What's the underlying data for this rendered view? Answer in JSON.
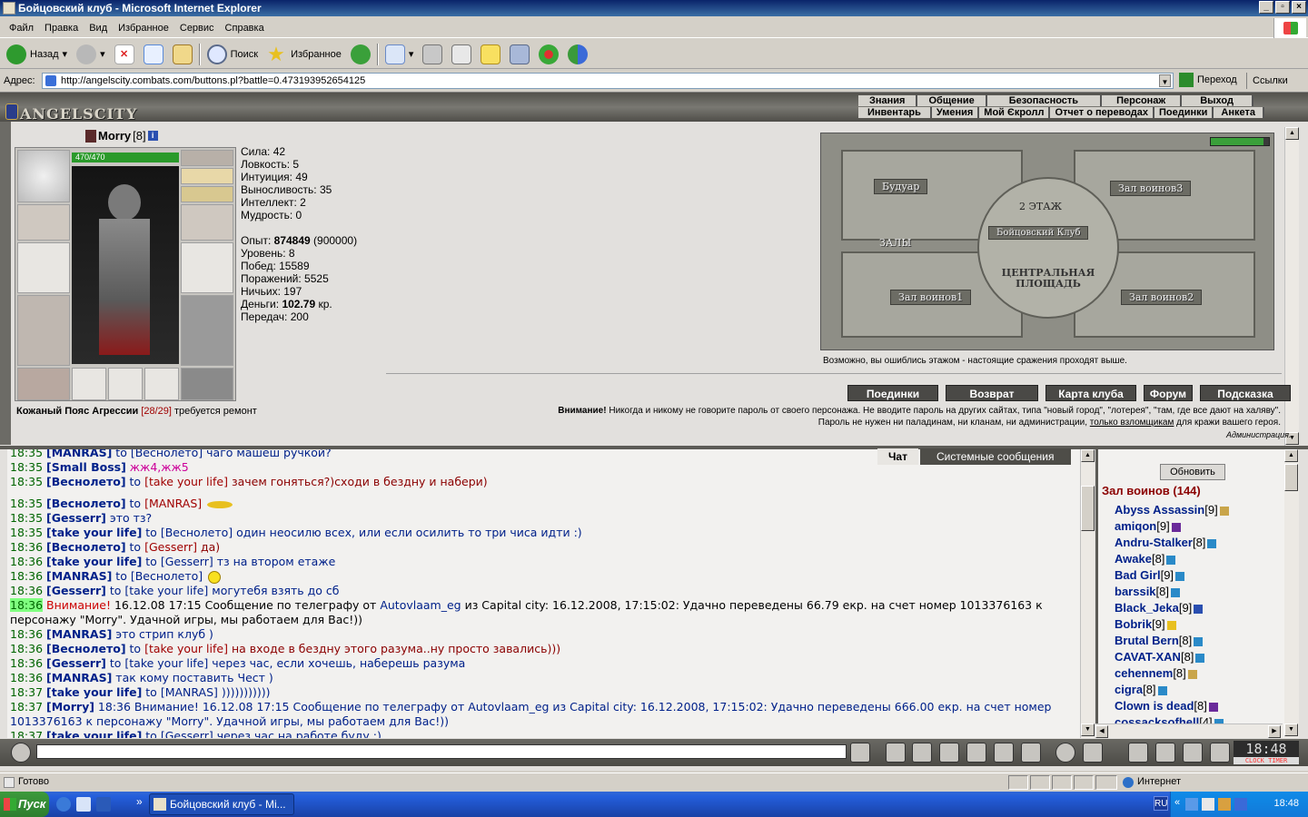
{
  "window": {
    "title": "Бойцовский клуб - Microsoft Internet Explorer"
  },
  "menu": [
    "Файл",
    "Правка",
    "Вид",
    "Избранное",
    "Сервис",
    "Справка"
  ],
  "toolbar": {
    "back": "Назад",
    "search": "Поиск",
    "favorites": "Избранное"
  },
  "address": {
    "label": "Адрес:",
    "url": "http://angelscity.combats.com/buttons.pl?battle=0.473193952654125",
    "go": "Переход",
    "links": "Ссылки"
  },
  "game": {
    "logo": "ANGELSCITY",
    "nav1": [
      "Знания",
      "Общение",
      "Безопасность",
      "Персонаж",
      "Выход"
    ],
    "nav2": [
      "Инвентарь",
      "Умения",
      "Мой Єкролл",
      "Отчет о переводах",
      "Поединки",
      "Анкета"
    ],
    "character": {
      "name": "Morry",
      "level": "[8]",
      "hp": "470/470",
      "hp_fraction": 1.0
    },
    "stats": {
      "strength": "Сила: 42",
      "agility": "Ловкость: 5",
      "intuition": "Интуиция: 49",
      "endurance": "Выносливость: 35",
      "intellect": "Интеллект: 2",
      "wisdom": "Мудрость: 0",
      "exp_label": "Опыт:",
      "exp_value": "874849",
      "exp_next": "(900000)",
      "level": "Уровень: 8",
      "wins": "Побед: 15589",
      "losses": "Поражений: 5525",
      "draws": "Ничьих: 197",
      "money_label": "Деньги:",
      "money_value": "102.79",
      "money_unit": "кр.",
      "transfers": "Передач: 200"
    },
    "belt": {
      "name": "Кожаный Пояс Агрессии",
      "durability": "[28/29]",
      "note": "требуется ремонт"
    },
    "map": {
      "boudoir": "Будуар",
      "floor2": "2 ЭТАЖ",
      "club": "Бойцовский Клуб",
      "halls": "ЗАЛЫ",
      "hall3": "Зал воинов3",
      "hall1": "Зал воинов1",
      "hall2": "Зал воинов2",
      "square": "ЦЕНТРАЛЬНАЯ ПЛОЩАДЬ",
      "note": "Возможно, вы ошиблись этажом - настоящие сражения проходят выше."
    },
    "buttons": [
      "Поединки",
      "Возврат",
      "Карта клуба",
      "Форум",
      "Подсказка"
    ],
    "warning": {
      "bold": "Внимание!",
      "text": "Никогда и никому не говорите пароль от своего персонажа. Не вводите пароль на других сайтах, типа \"новый город\", \"лотерея\", \"там, где все дают на халяву\".",
      "line2a": "Пароль не нужен ни паладинам, ни кланам, ни администрации,",
      "link": "только взломщикам",
      "line2b": "для кражи вашего героя.",
      "admin": "Администрация."
    }
  },
  "chat": {
    "tabs": [
      "Чат",
      "Системные сообщения"
    ],
    "lines": [
      {
        "time": "18:35",
        "nick": "[MANRAS]",
        "to": "to",
        "target": "[Веснолето]",
        "text": "чаго машеш ручкой?",
        "tcls": "msg"
      },
      {
        "time": "18:35",
        "nick": "[Small Boss]",
        "to": "",
        "target": "",
        "text": "жж4,жж5",
        "tcls": "mpink"
      },
      {
        "time": "18:35",
        "nick": "[Веснолето]",
        "to": "to",
        "target": "[take your life]",
        "text": "зачем гоняться?)сходи в бездну и набери)",
        "tcls": "msgr"
      },
      {
        "time": "18:35",
        "nick": "[Веснолето]",
        "to": "to",
        "target": "[MANRAS]",
        "text": "",
        "tcls": "msgr"
      },
      {
        "time": "18:35",
        "nick": "[Gesserr]",
        "to": "",
        "target": "",
        "text": "это тз?",
        "tcls": "msg"
      },
      {
        "time": "18:35",
        "nick": "[take your life]",
        "to": "to",
        "target": "[Веснолето]",
        "text": "один неосилю всех, или если осилить то три чиса идти :)",
        "tcls": "msg"
      },
      {
        "time": "18:36",
        "nick": "[Веснолето]",
        "to": "to",
        "target": "[Gesserr]",
        "text": "да)",
        "tcls": "msgr"
      },
      {
        "time": "18:36",
        "nick": "[take your life]",
        "to": "to",
        "target": "[Gesserr]",
        "text": "тз на втором етаже",
        "tcls": "msg"
      },
      {
        "time": "18:36",
        "nick": "[MANRAS]",
        "to": "to",
        "target": "[Веснолето]",
        "text": "",
        "tcls": "msg"
      },
      {
        "time": "18:36",
        "nick": "[Gesserr]",
        "to": "to",
        "target": "[take your life]",
        "text": "могутебя взять до сб",
        "tcls": "msg"
      }
    ],
    "sys": {
      "time": "18:36",
      "label": "Внимание!",
      "text1": "16.12.08 17:15 Сообщение по телеграфу от",
      "from": "Autovlaam_eg",
      "text2": "из Capital city: 16.12.2008, 17:15:02: Удачно переведены 66.79 екр. на счет номер 1013376163 к персонажу \"Morry\". Удачной игры, мы работаем для Вас!))"
    },
    "lines2": [
      {
        "time": "18:36",
        "nick": "[MANRAS]",
        "to": "",
        "target": "",
        "text": "это стрип клуб )",
        "tcls": "msg"
      },
      {
        "time": "18:36",
        "nick": "[Веснолето]",
        "to": "to",
        "target": "[take your life]",
        "text": "на входе в бездну этого разума..ну просто завались)))",
        "tcls": "msgr"
      },
      {
        "time": "18:36",
        "nick": "[Gesserr]",
        "to": "to",
        "target": "[take your life]",
        "text": "через час, если хочешь, наберешь разума",
        "tcls": "msg"
      },
      {
        "time": "18:36",
        "nick": "[MANRAS]",
        "to": "",
        "target": "",
        "text": "так кому поставить Чест )",
        "tcls": "msg"
      },
      {
        "time": "18:37",
        "nick": "[take your life]",
        "to": "to",
        "target": "[MANRAS]",
        "text": ")))))))))))",
        "tcls": "msg"
      }
    ],
    "morry": {
      "time": "18:37",
      "nick": "[Morry]",
      "text": "18:36 Внимание! 16.12.08 17:15 Сообщение по телеграфу от Autovlaam_eg из Capital city: 16.12.2008, 17:15:02: Удачно переведены 666.00 екр. на счет номер 1013376163 к персонажу \"Morry\". Удачной игры, мы работаем для Вас!))"
    },
    "last": {
      "time": "18:37",
      "nick": "[take your life]",
      "to": "to",
      "target": "[Gesserr]",
      "text": "через час на работе буду :)"
    }
  },
  "online": {
    "refresh": "Обновить",
    "room": "Зал воинов (144)",
    "players": [
      {
        "name": "Abyss Assassin",
        "lvl": "[9]",
        "align": "#c9a54a"
      },
      {
        "name": "amiqon",
        "lvl": "[9]",
        "align": "#6a2a9a"
      },
      {
        "name": "Andru-Stalker",
        "lvl": "[8]",
        "align": "#2a8ac8"
      },
      {
        "name": "Awake",
        "lvl": "[8]",
        "align": "#2a8ac8"
      },
      {
        "name": "Bad Girl",
        "lvl": "[9]",
        "align": "#2a8ac8"
      },
      {
        "name": "barssik",
        "lvl": "[8]",
        "align": "#2a8ac8"
      },
      {
        "name": "Black_Jeka",
        "lvl": "[9]",
        "align": "#2a4fb0"
      },
      {
        "name": "Bobrik",
        "lvl": "[9]",
        "align": "#e8c020"
      },
      {
        "name": "Brutal Bern",
        "lvl": "[8]",
        "align": "#2a8ac8"
      },
      {
        "name": "CAVAT-XAN",
        "lvl": "[8]",
        "align": "#2a8ac8"
      },
      {
        "name": "cehennem",
        "lvl": "[8]",
        "align": "#c9a54a"
      },
      {
        "name": "cigra",
        "lvl": "[8]",
        "align": "#2a8ac8"
      },
      {
        "name": "Clown is dead",
        "lvl": "[8]",
        "align": "#6a2a9a"
      },
      {
        "name": "cossacksofhell",
        "lvl": "[4]",
        "align": "#2a8ac8"
      }
    ]
  },
  "clock": {
    "time": "18:48",
    "labels": "CLOCK TIMER"
  },
  "status": {
    "text": "Готово",
    "zone": "Интернет"
  },
  "taskbar": {
    "start": "Пуск",
    "item": "Бойцовский клуб - Mi...",
    "time": "18:48",
    "lang": "RU"
  }
}
